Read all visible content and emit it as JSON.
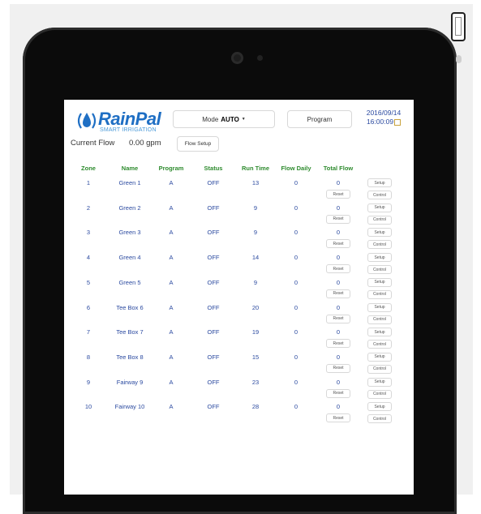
{
  "app": {
    "logo_name": "RainPal",
    "logo_tagline": "SMART IRRIGATION",
    "mode_label": "Mode",
    "mode_value": "AUTO",
    "program_label": "Program",
    "date": "2016/09/14",
    "time": "16:00:09",
    "current_flow_label": "Current Flow",
    "current_flow_value": "0.00 gpm",
    "flow_setup_label": "Flow Setup"
  },
  "table": {
    "headers": [
      "Zone",
      "Name",
      "Program",
      "Status",
      "Run Time",
      "Flow Daily",
      "Total Flow"
    ],
    "reset_label": "Reset",
    "setup_label": "Setup",
    "control_label": "Control",
    "rows": [
      {
        "zone": "1",
        "name": "Green 1",
        "program": "A",
        "status": "OFF",
        "run_time": "13",
        "flow_daily": "0",
        "total_flow": "0"
      },
      {
        "zone": "2",
        "name": "Green 2",
        "program": "A",
        "status": "OFF",
        "run_time": "9",
        "flow_daily": "0",
        "total_flow": "0"
      },
      {
        "zone": "3",
        "name": "Green 3",
        "program": "A",
        "status": "OFF",
        "run_time": "9",
        "flow_daily": "0",
        "total_flow": "0"
      },
      {
        "zone": "4",
        "name": "Green 4",
        "program": "A",
        "status": "OFF",
        "run_time": "14",
        "flow_daily": "0",
        "total_flow": "0"
      },
      {
        "zone": "5",
        "name": "Green 5",
        "program": "A",
        "status": "OFF",
        "run_time": "9",
        "flow_daily": "0",
        "total_flow": "0"
      },
      {
        "zone": "6",
        "name": "Tee Box 6",
        "program": "A",
        "status": "OFF",
        "run_time": "20",
        "flow_daily": "0",
        "total_flow": "0"
      },
      {
        "zone": "7",
        "name": "Tee Box 7",
        "program": "A",
        "status": "OFF",
        "run_time": "19",
        "flow_daily": "0",
        "total_flow": "0"
      },
      {
        "zone": "8",
        "name": "Tee Box 8",
        "program": "A",
        "status": "OFF",
        "run_time": "15",
        "flow_daily": "0",
        "total_flow": "0"
      },
      {
        "zone": "9",
        "name": "Fairway 9",
        "program": "A",
        "status": "OFF",
        "run_time": "23",
        "flow_daily": "0",
        "total_flow": "0"
      },
      {
        "zone": "10",
        "name": "Fairway 10",
        "program": "A",
        "status": "OFF",
        "run_time": "28",
        "flow_daily": "0",
        "total_flow": "0"
      }
    ]
  },
  "colors": {
    "header_green": "#2e8b2e",
    "cell_blue": "#2b4aa0",
    "logo_blue": "#1f6fc4"
  }
}
